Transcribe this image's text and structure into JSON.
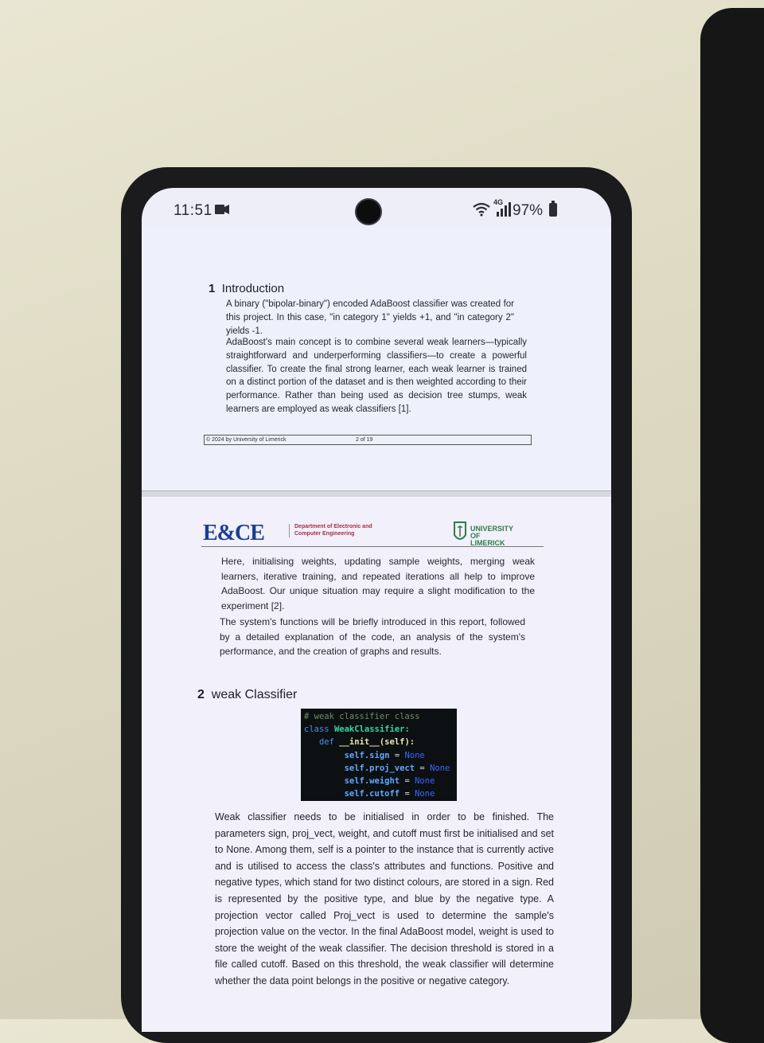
{
  "statusbar": {
    "time": "11:51",
    "network": "4G",
    "battery": "97%"
  },
  "page1": {
    "section": {
      "number": "1",
      "title": "Introduction"
    },
    "paragraphs": [
      "A binary (\"bipolar-binary\") encoded AdaBoost classifier was created for this project. In this case, \"in category 1\" yields +1, and \"in category 2\" yields -1.",
      "AdaBoost's main concept is to combine several weak learners—typically straightforward and underperforming classifiers—to create a powerful classifier. To create the final strong learner, each weak learner is trained on a distinct portion of the dataset and is then weighted according to their performance. Rather than being used as decision tree stumps, weak learners are employed as weak classifiers [1]."
    ],
    "footer": {
      "copyright": "© 2024 by University of Limerick",
      "page": "2 of 19"
    }
  },
  "page2": {
    "header": {
      "logo": "E&CE",
      "department": "Department of Electronic and Computer Engineering",
      "university": "UNIVERSITY OF LIMERICK"
    },
    "intro_paragraphs": [
      "Here, initialising weights, updating sample weights, merging weak learners, iterative training, and repeated iterations all help to improve AdaBoost. Our unique situation may require a slight modification to the experiment [2].",
      "The system's functions will be briefly introduced in this report, followed by a detailed explanation of the code, an analysis of the system's performance, and the creation of graphs and results."
    ],
    "section": {
      "number": "2",
      "title": "weak Classifier"
    },
    "code": {
      "comment": "# weak classifier class",
      "kw_class": "class",
      "class_name": "WeakClassifier:",
      "kw_def": "def",
      "method": "__init__(self):",
      "attrs": [
        "self.sign",
        "self.proj_vect",
        "self.weight",
        "self.cutoff"
      ],
      "eq": "=",
      "none": "None"
    },
    "body": "Weak classifier needs to be initialised in order to be finished. The parameters sign, proj_vect, weight, and cutoff must first be initialised and set to None. Among them, self is a pointer to the instance that is currently active and is utilised to access the class's attributes and functions. Positive and negative types, which stand for two distinct colours, are stored in a sign. Red is represented by the positive type, and blue by the negative type. A projection vector called Proj_vect is used to determine the sample's projection value on the vector. In the final AdaBoost model, weight is used to store the weight of the weak classifier. The decision threshold is stored in a file called cutoff. Based on this threshold, the weak classifier will determine whether the data point belongs in the positive or negative category."
  }
}
